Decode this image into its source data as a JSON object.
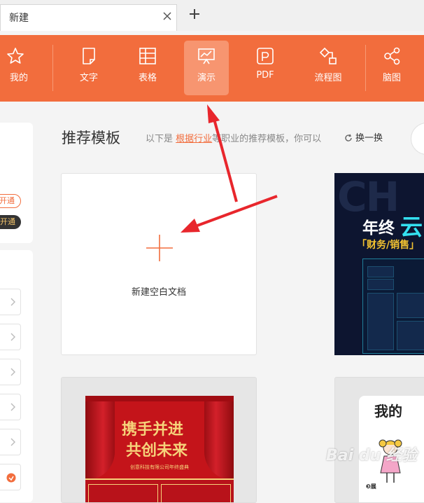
{
  "tab": {
    "title": "新建",
    "close_icon": "close-icon",
    "new_tab_icon": "plus-icon"
  },
  "toolbar": {
    "background": "#f26d3d",
    "items": [
      {
        "label": "我的",
        "icon": "star-icon"
      },
      {
        "label": "文字",
        "icon": "document-icon"
      },
      {
        "label": "表格",
        "icon": "table-icon"
      },
      {
        "label": "演示",
        "icon": "presentation-icon",
        "active": true
      },
      {
        "label": "PDF",
        "icon": "pdf-icon"
      },
      {
        "label": "流程图",
        "icon": "flowchart-icon"
      },
      {
        "label": "脑图",
        "icon": "mindmap-icon"
      }
    ]
  },
  "sidebar": {
    "pill_open": "开通",
    "pill_vip": "开通"
  },
  "main": {
    "heading": "推荐模板",
    "subtitle_prefix": "以下是",
    "subtitle_link": "根据行业",
    "subtitle_suffix": "等职业的推荐模板，你可以",
    "refresh_label": "换一换"
  },
  "cards": {
    "new_blank": "新建空白文档",
    "dark_bg_text": "CH",
    "dark_title": "年终",
    "dark_title_big": "云",
    "dark_subtitle": "「财务/销售」",
    "red_line1": "携手并进",
    "red_line2": "共创未来",
    "red_small": "创意科技有限公司年终盛典",
    "white_title": "我的",
    "white_label": "❸展"
  },
  "watermark": "Bai du 经验"
}
